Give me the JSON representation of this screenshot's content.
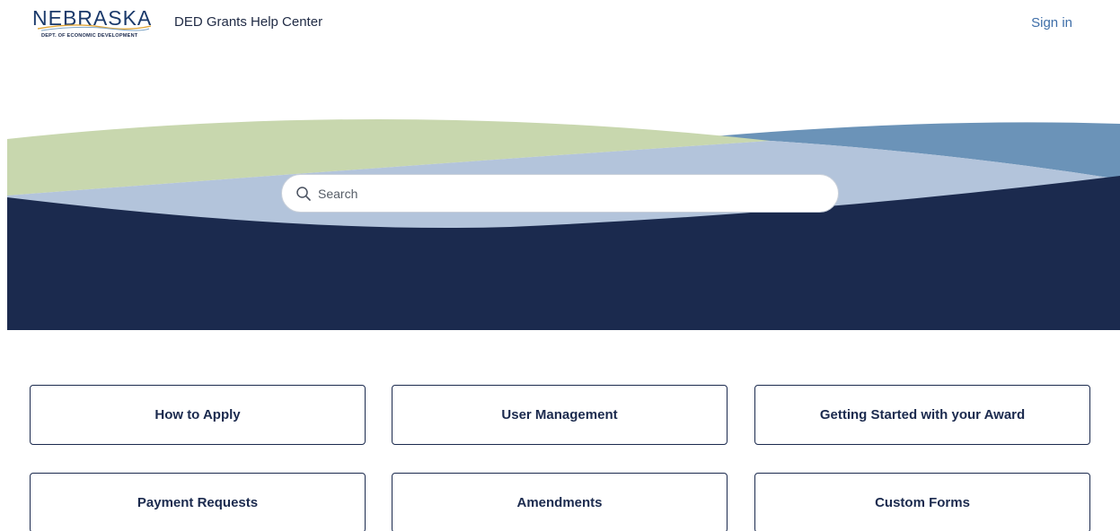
{
  "header": {
    "logo_word": "NEBRASKA",
    "logo_subtitle": "DEPT. OF ECONOMIC DEVELOPMENT",
    "site_title": "DED Grants Help Center",
    "sign_in_label": "Sign in"
  },
  "search": {
    "placeholder": "Search",
    "value": ""
  },
  "categories": [
    {
      "label": "How to Apply"
    },
    {
      "label": "User Management"
    },
    {
      "label": "Getting Started with your Award"
    },
    {
      "label": "Payment Requests"
    },
    {
      "label": "Amendments"
    },
    {
      "label": "Custom Forms"
    }
  ],
  "colors": {
    "navy": "#1b2a4e",
    "green": "#c8d7ae",
    "light_blue": "#b3c4db",
    "mid_blue": "#6b93b8",
    "link": "#3e6ea8"
  }
}
